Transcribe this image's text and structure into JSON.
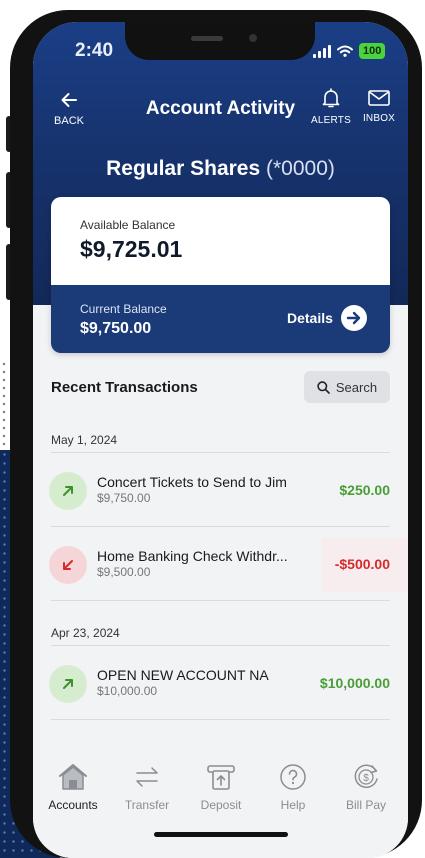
{
  "status": {
    "time": "2:40",
    "battery": "100"
  },
  "nav": {
    "back": "BACK",
    "title": "Account Activity",
    "alerts": "ALERTS",
    "inbox": "INBOX"
  },
  "account": {
    "name": "Regular Shares",
    "mask": "(*0000)"
  },
  "balance": {
    "available_label": "Available Balance",
    "available_value": "$9,725.01",
    "current_label": "Current Balance",
    "current_value": "$9,750.00",
    "details_label": "Details"
  },
  "recent": {
    "title": "Recent Transactions",
    "search_label": "Search"
  },
  "groups": [
    {
      "date": "May 1, 2024",
      "transactions": [
        {
          "name": "Concert Tickets to Send to Jim",
          "balance": "$9,750.00",
          "amount": "$250.00",
          "direction": "in"
        },
        {
          "name": "Home Banking Check Withdr...",
          "balance": "$9,500.00",
          "amount": "-$500.00",
          "direction": "out"
        }
      ]
    },
    {
      "date": "Apr 23, 2024",
      "transactions": [
        {
          "name": "OPEN NEW ACCOUNT NA",
          "balance": "$10,000.00",
          "amount": "$10,000.00",
          "direction": "in"
        }
      ]
    }
  ],
  "tabs": [
    {
      "label": "Accounts",
      "icon": "house-icon",
      "active": true
    },
    {
      "label": "Transfer",
      "icon": "transfer-arrows-icon",
      "active": false
    },
    {
      "label": "Deposit",
      "icon": "deposit-check-icon",
      "active": false
    },
    {
      "label": "Help",
      "icon": "help-question-icon",
      "active": false
    },
    {
      "label": "Bill Pay",
      "icon": "bill-pay-dollar-icon",
      "active": false
    }
  ],
  "colors": {
    "header": "#17336e",
    "card_dark": "#1a3a78",
    "positive": "#4a9d36",
    "negative": "#d42c2c",
    "battery": "#4ad33b"
  }
}
